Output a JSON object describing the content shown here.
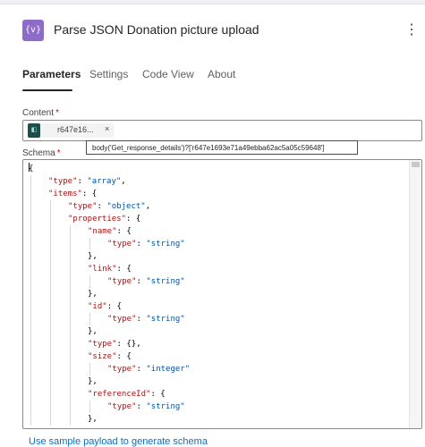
{
  "header": {
    "icon_text": "{v}",
    "title": "Parse JSON Donation picture upload",
    "more": "⋮"
  },
  "tabs": [
    "Parameters",
    "Settings",
    "Code View",
    "About"
  ],
  "content": {
    "label": "Content",
    "required": "*",
    "token_text": "r647e16...",
    "token_close": "×",
    "tooltip": "body('Get_response_details')?['r647e1693e71a49ebba62ac5a05c59648']"
  },
  "schema": {
    "label": "Schema",
    "required": "*",
    "lines": [
      {
        "indent": 0,
        "parts": [
          {
            "t": "{",
            "c": "p"
          }
        ]
      },
      {
        "indent": 1,
        "parts": [
          {
            "t": "\"type\"",
            "c": "k"
          },
          {
            "t": ": ",
            "c": "p"
          },
          {
            "t": "\"array\"",
            "c": "s"
          },
          {
            "t": ",",
            "c": "p"
          }
        ]
      },
      {
        "indent": 1,
        "parts": [
          {
            "t": "\"items\"",
            "c": "k"
          },
          {
            "t": ": {",
            "c": "p"
          }
        ]
      },
      {
        "indent": 2,
        "parts": [
          {
            "t": "\"type\"",
            "c": "k"
          },
          {
            "t": ": ",
            "c": "p"
          },
          {
            "t": "\"object\"",
            "c": "s"
          },
          {
            "t": ",",
            "c": "p"
          }
        ]
      },
      {
        "indent": 2,
        "parts": [
          {
            "t": "\"properties\"",
            "c": "k"
          },
          {
            "t": ": {",
            "c": "p"
          }
        ]
      },
      {
        "indent": 3,
        "parts": [
          {
            "t": "\"name\"",
            "c": "k"
          },
          {
            "t": ": {",
            "c": "p"
          }
        ]
      },
      {
        "indent": 4,
        "parts": [
          {
            "t": "\"type\"",
            "c": "k"
          },
          {
            "t": ": ",
            "c": "p"
          },
          {
            "t": "\"string\"",
            "c": "s"
          }
        ]
      },
      {
        "indent": 3,
        "parts": [
          {
            "t": "},",
            "c": "p"
          }
        ]
      },
      {
        "indent": 3,
        "parts": [
          {
            "t": "\"link\"",
            "c": "k"
          },
          {
            "t": ": {",
            "c": "p"
          }
        ]
      },
      {
        "indent": 4,
        "parts": [
          {
            "t": "\"type\"",
            "c": "k"
          },
          {
            "t": ": ",
            "c": "p"
          },
          {
            "t": "\"string\"",
            "c": "s"
          }
        ]
      },
      {
        "indent": 3,
        "parts": [
          {
            "t": "},",
            "c": "p"
          }
        ]
      },
      {
        "indent": 3,
        "parts": [
          {
            "t": "\"id\"",
            "c": "k"
          },
          {
            "t": ": {",
            "c": "p"
          }
        ]
      },
      {
        "indent": 4,
        "parts": [
          {
            "t": "\"type\"",
            "c": "k"
          },
          {
            "t": ": ",
            "c": "p"
          },
          {
            "t": "\"string\"",
            "c": "s"
          }
        ]
      },
      {
        "indent": 3,
        "parts": [
          {
            "t": "},",
            "c": "p"
          }
        ]
      },
      {
        "indent": 3,
        "parts": [
          {
            "t": "\"type\"",
            "c": "k"
          },
          {
            "t": ": {},",
            "c": "p"
          }
        ]
      },
      {
        "indent": 3,
        "parts": [
          {
            "t": "\"size\"",
            "c": "k"
          },
          {
            "t": ": {",
            "c": "p"
          }
        ]
      },
      {
        "indent": 4,
        "parts": [
          {
            "t": "\"type\"",
            "c": "k"
          },
          {
            "t": ": ",
            "c": "p"
          },
          {
            "t": "\"integer\"",
            "c": "s"
          }
        ]
      },
      {
        "indent": 3,
        "parts": [
          {
            "t": "},",
            "c": "p"
          }
        ]
      },
      {
        "indent": 3,
        "parts": [
          {
            "t": "\"referenceId\"",
            "c": "k"
          },
          {
            "t": ": {",
            "c": "p"
          }
        ]
      },
      {
        "indent": 4,
        "parts": [
          {
            "t": "\"type\"",
            "c": "k"
          },
          {
            "t": ": ",
            "c": "p"
          },
          {
            "t": "\"string\"",
            "c": "s"
          }
        ]
      },
      {
        "indent": 3,
        "parts": [
          {
            "t": "},",
            "c": "p"
          }
        ]
      }
    ]
  },
  "sample_link": "Use sample payload to generate schema",
  "colors": {
    "accent": "#8c6cc7",
    "link": "#0f6cbd",
    "json_key": "#a31515",
    "json_string": "#0451a5",
    "required": "#c50f1f"
  }
}
